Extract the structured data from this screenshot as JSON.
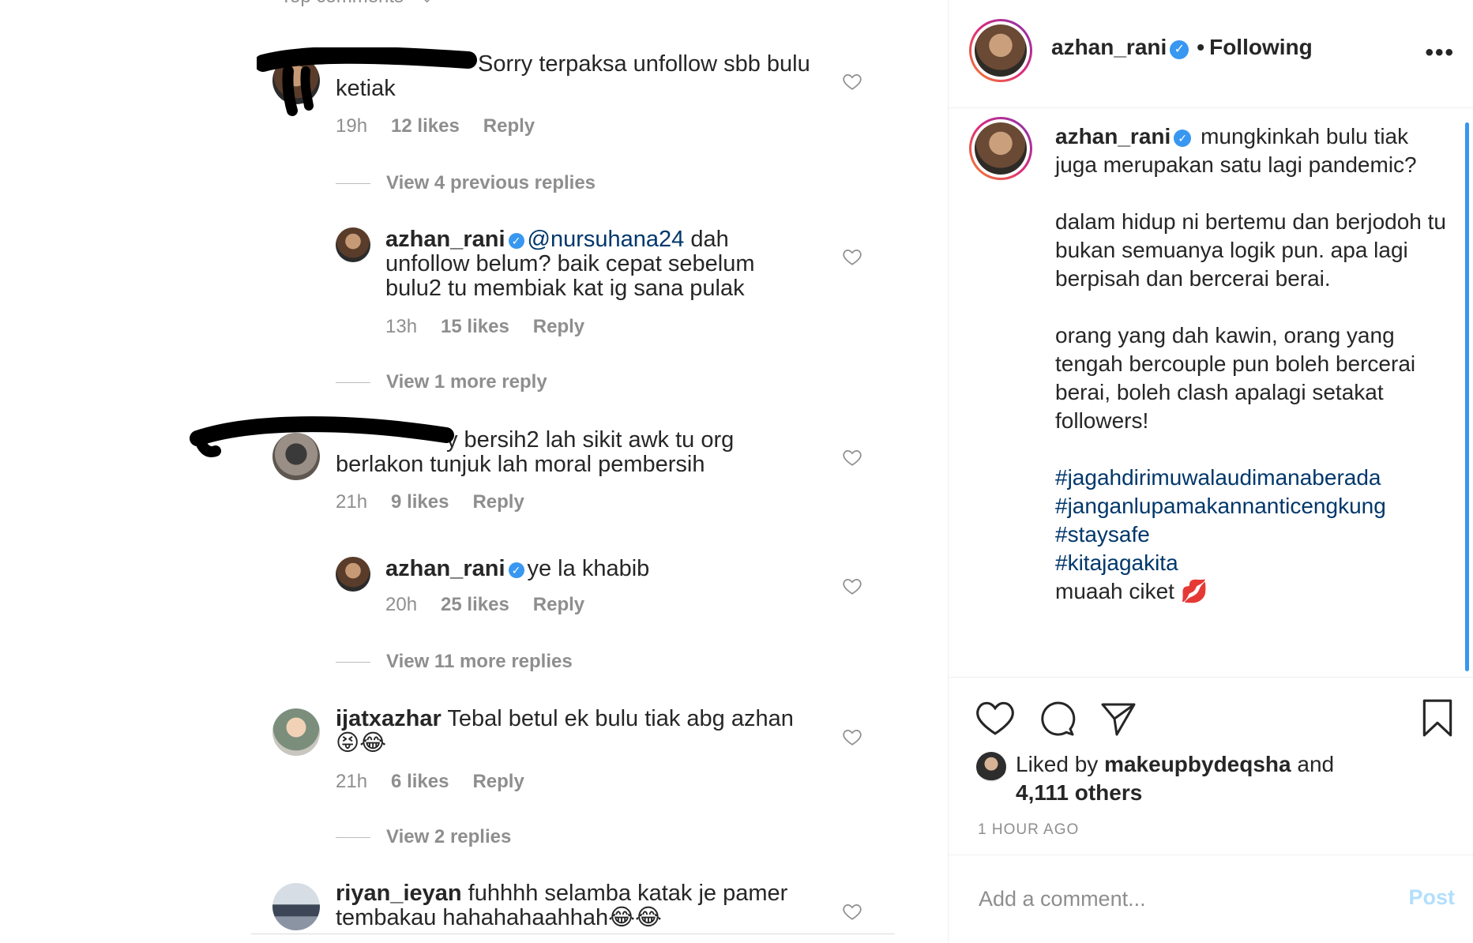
{
  "top_comments_label": "Top comments",
  "comments": [
    {
      "username": "",
      "text": "Sorry terpaksa unfollow sbb bulu ketiak",
      "time": "19h",
      "likes": "12 likes",
      "reply": "Reply",
      "view_replies": "View 4 previous replies"
    },
    {
      "username": "azhan_rani",
      "mention": "@nursuhana24",
      "text": " dah unfollow belum? baik cepat sebelum bulu2 tu membiak kat ig sana pulak",
      "time": "13h",
      "likes": "15 likes",
      "reply": "Reply",
      "view_replies": "View 1 more reply"
    },
    {
      "username": "",
      "text": "y bersih2 lah sikit awk tu  org berlakon tunjuk lah moral pembersih",
      "time": "21h",
      "likes": "9 likes",
      "reply": "Reply"
    },
    {
      "username": "azhan_rani",
      "text": "ye la khabib",
      "time": "20h",
      "likes": "25 likes",
      "reply": "Reply",
      "view_replies": "View 11 more replies"
    },
    {
      "username": "ijatxazhar",
      "text": "Tebal betul ek bulu tiak abg azhan 😝😂",
      "time": "21h",
      "likes": "6 likes",
      "reply": "Reply",
      "view_replies": "View 2 replies"
    },
    {
      "username": "riyan_ieyan",
      "text": "fuhhhh selamba katak je pamer tembakau hahahahaahhah😂😂"
    }
  ],
  "header": {
    "username": "azhan_rani",
    "dot": "•",
    "following": "Following",
    "more": "•••"
  },
  "caption": {
    "username": "azhan_rani",
    "p1": "mungkinkah bulu tiak juga merupakan satu lagi pandemic?",
    "p2": "dalam hidup ni bertemu dan berjodoh tu bukan semuanya logik pun. apa lagi berpisah dan bercerai berai.",
    "p3": "orang yang dah kawin, orang yang tengah bercouple pun boleh bercerai berai, boleh clash apalagi setakat followers!",
    "hashtags": [
      "#jagahdirimuwalaudimanaberada",
      "#janganlupamakannanticengkung",
      "#staysafe",
      "#kitajagakita"
    ],
    "closing": "muaah ciket 💋"
  },
  "likes": {
    "prefix": "Liked by ",
    "user": "makeupbydeqsha",
    "middle": " and ",
    "others": "4,111 others"
  },
  "time_ago": "1 HOUR AGO",
  "add_comment": {
    "placeholder": "Add a comment...",
    "post": "Post"
  },
  "icons": {
    "heart": "heart-icon",
    "comment": "comment-icon",
    "share": "paper-plane-icon",
    "save": "bookmark-icon",
    "verified": "verified-badge-icon"
  },
  "colors": {
    "link": "#00376b",
    "verified": "#3897f0",
    "muted": "#8e8e8e",
    "post_disabled": "#b2dffc"
  }
}
